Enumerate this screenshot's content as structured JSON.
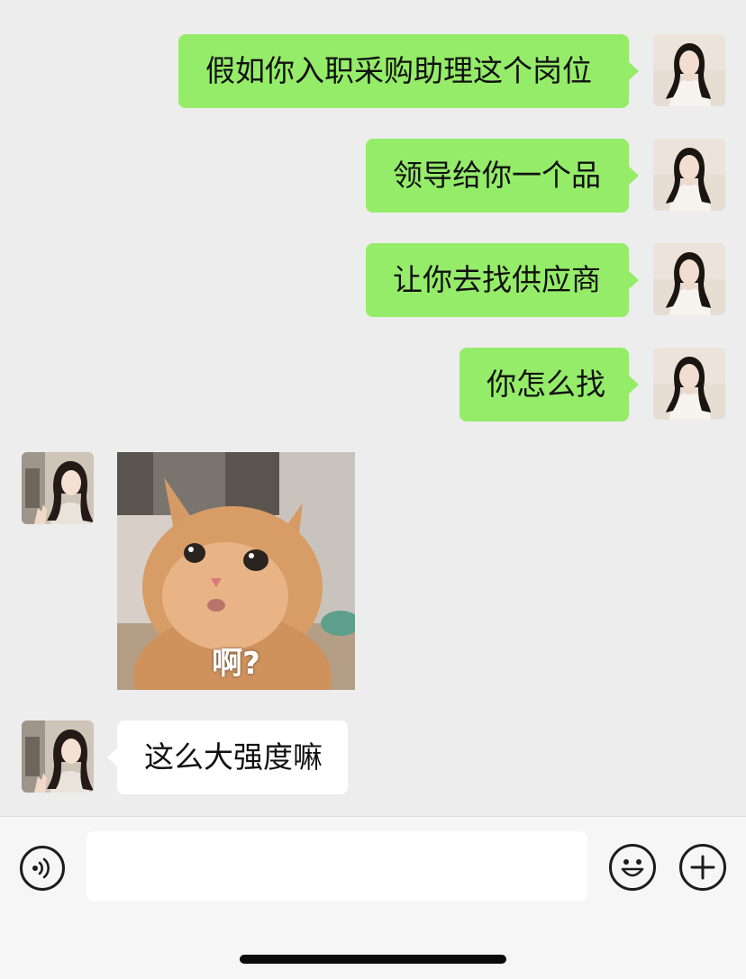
{
  "chat": {
    "messages": [
      {
        "from": "me",
        "type": "text",
        "text": "假如你入职采购助理这个岗位"
      },
      {
        "from": "me",
        "type": "text",
        "text": "领导给你一个品"
      },
      {
        "from": "me",
        "type": "text",
        "text": "让你去找供应商"
      },
      {
        "from": "me",
        "type": "text",
        "text": "你怎么找"
      },
      {
        "from": "them",
        "type": "sticker",
        "caption": "啊?",
        "icon": "confused-cat-sticker"
      },
      {
        "from": "them",
        "type": "text",
        "text": "这么大强度嘛"
      }
    ]
  },
  "input_bar": {
    "voice_icon": "voice-input-icon",
    "text_value": "",
    "emoji_icon": "emoji-icon",
    "more_icon": "plus-icon"
  },
  "colors": {
    "background": "#ededed",
    "my_bubble": "#95ec69",
    "their_bubble": "#ffffff",
    "input_bar": "#f6f6f6"
  }
}
